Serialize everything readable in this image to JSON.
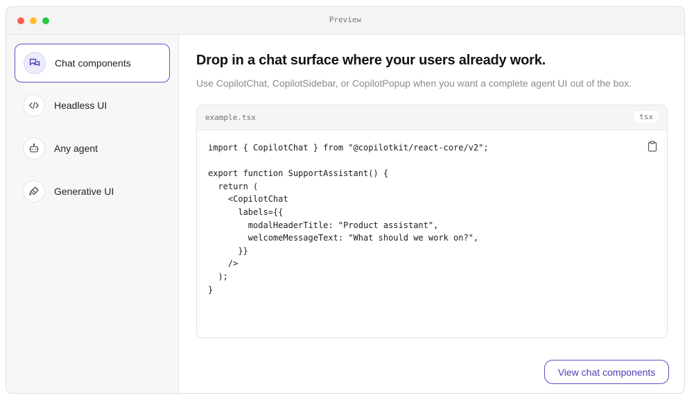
{
  "window": {
    "title": "Preview"
  },
  "sidebar": {
    "items": [
      {
        "label": "Chat components",
        "icon": "chat-bubbles-icon",
        "active": true
      },
      {
        "label": "Headless UI",
        "icon": "code-icon",
        "active": false
      },
      {
        "label": "Any agent",
        "icon": "robot-icon",
        "active": false
      },
      {
        "label": "Generative UI",
        "icon": "paint-brush-icon",
        "active": false
      }
    ]
  },
  "main": {
    "heading": "Drop in a chat surface where your users already work.",
    "subtext": "Use CopilotChat, CopilotSidebar, or CopilotPopup when you want a complete agent UI out of the box.",
    "code": {
      "filename": "example.tsx",
      "language": "tsx",
      "copy_icon": "clipboard-icon",
      "content": "import { CopilotChat } from \"@copilotkit/react-core/v2\";\n\nexport function SupportAssistant() {\n  return (\n    <CopilotChat\n      labels={{\n        modalHeaderTitle: \"Product assistant\",\n        welcomeMessageText: \"What should we work on?\",\n      }}\n    />\n  );\n}"
    },
    "cta_label": "View chat components"
  },
  "colors": {
    "accent": "#5b4fc7",
    "accent_text": "#4a3fb8",
    "window_close": "#fe5f57",
    "window_minimize": "#febc2e",
    "window_zoom": "#28c840"
  }
}
